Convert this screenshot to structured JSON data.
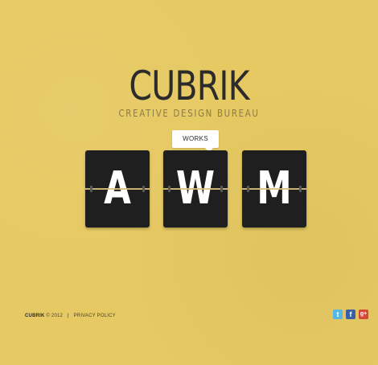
{
  "logo": {
    "title": "CUBRIK",
    "subtitle": "CREATIVE DESIGN BUREAU"
  },
  "tooltip": {
    "label": "WORKS"
  },
  "tiles": [
    {
      "letter": "A"
    },
    {
      "letter": "W"
    },
    {
      "letter": "M"
    }
  ],
  "footer": {
    "brand": "CUBRIK",
    "copyright": "© 2012",
    "separator": "|",
    "privacy_link": "PRIVACY POLICY"
  },
  "socials": {
    "twitter_glyph": "t",
    "facebook_glyph": "f",
    "gplus_glyph": "g+",
    "icons": [
      "twitter-icon",
      "facebook-icon",
      "google-plus-icon"
    ]
  },
  "colors": {
    "background": "#e6c962",
    "tile": "#1f1f1f",
    "tooltip": "#ffffff",
    "text_dark": "#2b2b2b"
  }
}
